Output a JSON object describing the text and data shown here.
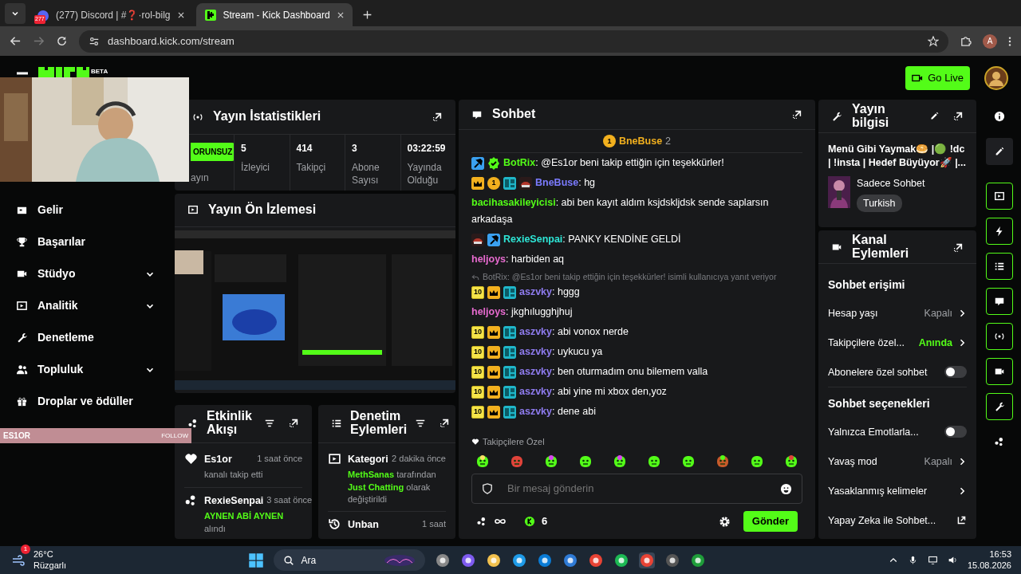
{
  "browser": {
    "tabs": [
      {
        "title": "(277) Discord | #❓·rol-bilg",
        "selected": false,
        "badge": "277"
      },
      {
        "title": "Stream - Kick Dashboard",
        "selected": true
      }
    ],
    "address": "dashboard.kick.com/stream",
    "profile": "A"
  },
  "header": {
    "logo_tag": "BETA",
    "go_live": "Go Live"
  },
  "overlay": {
    "follower": "ES1OR",
    "label": "FOLLOW"
  },
  "sidebar": {
    "items": [
      {
        "label": "Gelir",
        "expandable": false
      },
      {
        "label": "Başarılar",
        "expandable": false
      },
      {
        "label": "Stüdyo",
        "expandable": true
      },
      {
        "label": "Analitik",
        "expandable": true
      },
      {
        "label": "Denetleme",
        "expandable": false
      },
      {
        "label": "Topluluk",
        "expandable": true
      },
      {
        "label": "Droplar ve ödüller",
        "expandable": false
      }
    ]
  },
  "stats": {
    "title": "Yayın İstatistikleri",
    "status": "ORUNSUZ",
    "status_label": "ayın",
    "items": [
      {
        "value": "5",
        "label": "İzleyici"
      },
      {
        "value": "414",
        "label": "Takipçi"
      },
      {
        "value": "3",
        "label": "Abone Sayısı"
      },
      {
        "value": "03:22:59",
        "label": "Yayında Olduğu"
      }
    ]
  },
  "preview": {
    "title": "Yayın Ön İzlemesi"
  },
  "activity": {
    "title": "Etkinlik Akışı",
    "items": [
      {
        "kind": "follow",
        "user": "Es1or",
        "time": "1 saat önce",
        "parts": [
          {
            "text": "kanalı takip etti",
            "accent": false
          }
        ]
      },
      {
        "kind": "reward",
        "user": "RexieSenpai",
        "time": "3 saat önce",
        "parts": [
          {
            "text": "AYNEN ABİ AYNEN",
            "accent": true
          },
          {
            "text": "alındı",
            "accent": false
          }
        ]
      }
    ]
  },
  "moderation": {
    "title": "Denetim Eylemleri",
    "items": [
      {
        "kind": "category",
        "action": "Kategori",
        "time": "2 dakika önce",
        "parts": [
          {
            "text": "MethSanas",
            "accent": true
          },
          {
            "text": "tarafından",
            "accent": false
          },
          {
            "text": "Just Chatting",
            "accent": true
          },
          {
            "text": "olarak değiştirildi",
            "accent": false
          }
        ]
      },
      {
        "kind": "unban",
        "action": "Unban",
        "time": "1 saat"
      }
    ]
  },
  "chat": {
    "title": "Sohbet",
    "pinned": {
      "badge": "1",
      "user": "BneBuse",
      "count": "2"
    },
    "messages": [
      {
        "badges": [
          {
            "kind": "mod"
          },
          {
            "kind": "verified"
          }
        ],
        "user": "BotRix",
        "color": "#53fc18",
        "text": ": @Es1or beni takip ettiğin için teşekkürler!"
      },
      {
        "badges": [
          {
            "kind": "crown"
          },
          {
            "kind": "coin",
            "label": "1"
          },
          {
            "kind": "og"
          },
          {
            "kind": "sticker"
          }
        ],
        "user": "BneBuse",
        "color": "#7b7bff",
        "text": ": hg"
      },
      {
        "user": "bacihasakileyicisi",
        "color": "#53fc18",
        "text": ": abi ben kayıt aldım ksjdskljdsk sende saplarsın arkadaşa"
      },
      {
        "badges": [
          {
            "kind": "sticker"
          },
          {
            "kind": "mod"
          }
        ],
        "user": "RexieSenpai",
        "color": "#2ee6d6",
        "text": ": PANKY KENDİNE GELDİ"
      },
      {
        "user": "heljoys",
        "color": "#e86bd0",
        "text": ": harbiden aq"
      },
      {
        "badges": [
          {
            "kind": "months",
            "label": "10"
          },
          {
            "kind": "crown"
          },
          {
            "kind": "og"
          }
        ],
        "user": "aszvky",
        "color": "#8f7cf0",
        "text": ": hggg",
        "reply": "BotRix: @Es1or beni takip ettiğin için teşekkürler! isimli kullanıcıya yanıt veriyor"
      },
      {
        "user": "heljoys",
        "color": "#e86bd0",
        "text": ": jkghılugghjhuj"
      },
      {
        "badges": [
          {
            "kind": "months",
            "label": "10"
          },
          {
            "kind": "crown"
          },
          {
            "kind": "og"
          }
        ],
        "user": "aszvky",
        "color": "#8f7cf0",
        "text": ": abi vonox nerde"
      },
      {
        "badges": [
          {
            "kind": "months",
            "label": "10"
          },
          {
            "kind": "crown"
          },
          {
            "kind": "og"
          }
        ],
        "user": "aszvky",
        "color": "#8f7cf0",
        "text": ": uykucu ya"
      },
      {
        "badges": [
          {
            "kind": "months",
            "label": "10"
          },
          {
            "kind": "crown"
          },
          {
            "kind": "og"
          }
        ],
        "user": "aszvky",
        "color": "#8f7cf0",
        "text": ": ben oturmadım onu bilemem valla"
      },
      {
        "badges": [
          {
            "kind": "months",
            "label": "10"
          },
          {
            "kind": "crown"
          },
          {
            "kind": "og"
          }
        ],
        "user": "aszvky",
        "color": "#8f7cf0",
        "text": ": abi yine mi xbox den,yoz"
      },
      {
        "badges": [
          {
            "kind": "months",
            "label": "10"
          },
          {
            "kind": "crown"
          },
          {
            "kind": "og"
          }
        ],
        "user": "aszvky",
        "color": "#8f7cf0",
        "text": ": dene abi"
      }
    ],
    "emote_label": "Takipçilere Özel",
    "emotes": [
      {
        "kind": "halo"
      },
      {
        "kind": "angry"
      },
      {
        "kind": "headset"
      },
      {
        "kind": "smile"
      },
      {
        "kind": "headset"
      },
      {
        "kind": "smile"
      },
      {
        "kind": "smile"
      },
      {
        "kind": "burger"
      },
      {
        "kind": "smile"
      },
      {
        "kind": "cry"
      }
    ],
    "placeholder": "Bir mesaj gönderin",
    "points": "6",
    "send": "Gönder"
  },
  "stream_info": {
    "title": "Yayın bilgisi",
    "stream_title": "Menü Gibi Yaymak🥯 |🟢 !dc | !insta | Hedef Büyüyor🚀 |...",
    "category": "Sadece Sohbet",
    "language": "Turkish"
  },
  "channel_actions": {
    "title": "Kanal Eylemleri",
    "sections": [
      {
        "heading": "Sohbet erişimi",
        "rows": [
          {
            "kind": "select",
            "label": "Hesap yaşı",
            "value": "Kapalı",
            "active": false
          },
          {
            "kind": "select",
            "label": "Takipçilere özel...",
            "value": "Anında",
            "active": true
          },
          {
            "kind": "toggle",
            "label": "Abonelere özel sohbet",
            "on": false
          }
        ]
      },
      {
        "heading": "Sohbet seçenekleri",
        "rows": [
          {
            "kind": "toggle",
            "label": "Yalnızca Emotlarla...",
            "on": false
          },
          {
            "kind": "select",
            "label": "Yavaş mod",
            "value": "Kapalı",
            "active": false
          },
          {
            "kind": "link",
            "label": "Yasaklanmış kelimeler"
          },
          {
            "kind": "external",
            "label": "Yapay Zeka ile Sohbet..."
          }
        ]
      }
    ]
  },
  "rail": [
    {
      "kind": "plain",
      "selected": false
    },
    {
      "kind": "plain",
      "selected": true
    },
    {
      "kind": "panel",
      "selected": false
    },
    {
      "kind": "panel",
      "selected": false
    },
    {
      "kind": "panel",
      "selected": false
    },
    {
      "kind": "panel",
      "selected": false
    },
    {
      "kind": "panel",
      "selected": false
    },
    {
      "kind": "panel",
      "selected": false
    },
    {
      "kind": "panel",
      "selected": false
    },
    {
      "kind": "plain",
      "selected": false
    }
  ],
  "taskbar": {
    "weather_badge": "1",
    "temp": "26°C",
    "condition": "Rüzgarlı",
    "search": "Ara",
    "time": "16:53",
    "date": "15.08.2026"
  }
}
